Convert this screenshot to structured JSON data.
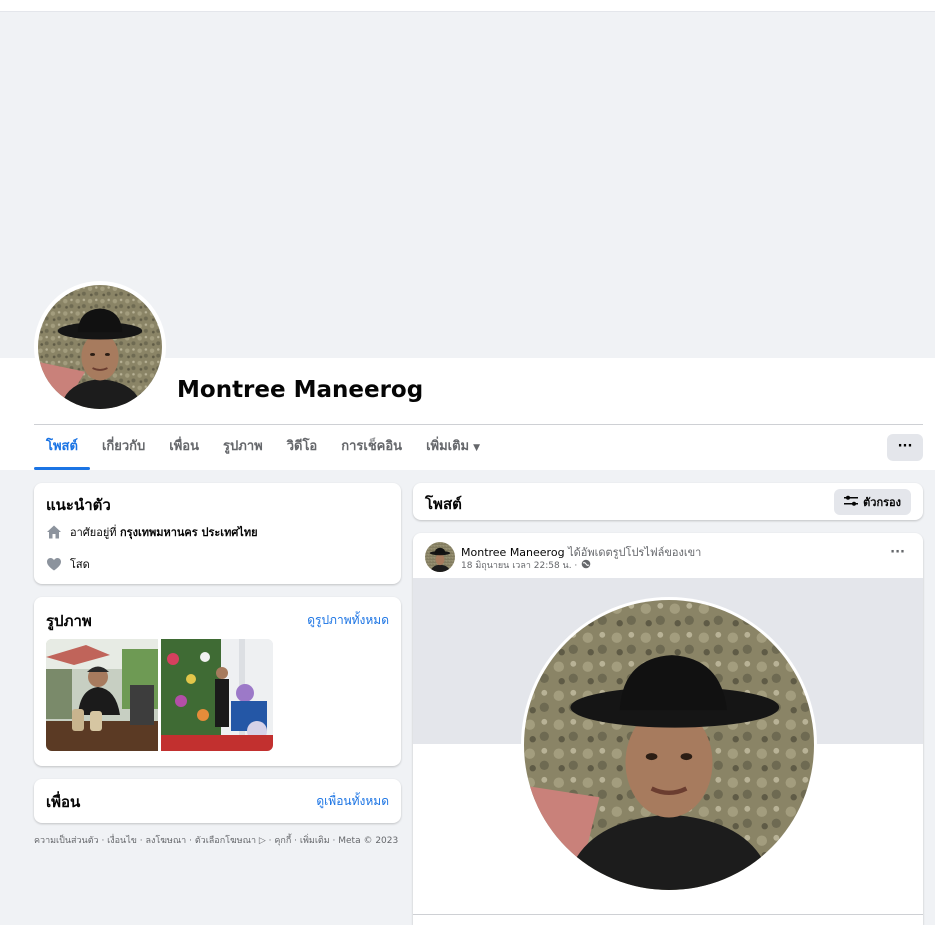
{
  "profile": {
    "name": "Montree Maneerog"
  },
  "tabs": [
    {
      "label": "โพสต์"
    },
    {
      "label": "เกี่ยวกับ"
    },
    {
      "label": "เพื่อน"
    },
    {
      "label": "รูปภาพ"
    },
    {
      "label": "วิดีโอ"
    },
    {
      "label": "การเช็คอิน"
    },
    {
      "label": "เพิ่มเติม"
    }
  ],
  "more_button": "···",
  "intro": {
    "title": "แนะนำตัว",
    "lives_in_prefix": "อาศัยอยู่ที่",
    "lives_in_city": "กรุงเทพมหานคร ประเทศไทย",
    "relationship": "โสด"
  },
  "photos": {
    "title": "รูปภาพ",
    "see_all": "ดูรูปภาพทั้งหมด"
  },
  "friends": {
    "title": "เพื่อน",
    "see_all": "ดูเพื่อนทั้งหมด"
  },
  "footer": "ความเป็นส่วนตัว · เงื่อนไข · ลงโฆษณา · ตัวเลือกโฆษณา ▷ · คุกกี้ · เพิ่มเติม · Meta © 2023",
  "posts_section": {
    "title": "โพสต์",
    "filter_label": "ตัวกรอง"
  },
  "post": {
    "author": "Montree Maneerog",
    "action": "ได้อัพเดตรูปโปรไฟล์ของเขา",
    "timestamp": "18 มิถุนายน เวลา 22:58 น. ·",
    "menu": "···"
  },
  "colors": {
    "accent": "#1b74e4",
    "background": "#f0f2f5",
    "card": "#ffffff",
    "secondary_text": "#65676b"
  }
}
